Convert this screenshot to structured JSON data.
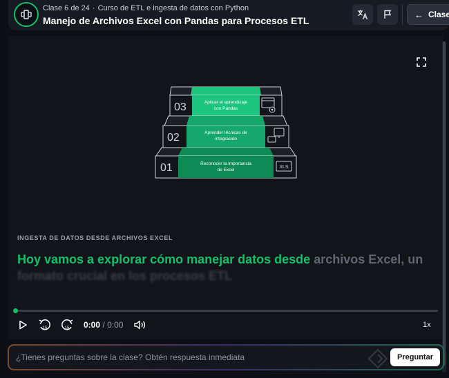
{
  "header": {
    "class_position": "Clase 6 de 24",
    "separator": "·",
    "course_name": "Curso de ETL e ingesta de datos con Python",
    "lesson_title": "Manejo de Archivos Excel con Pandas para Procesos ETL",
    "classes_button": "Clases",
    "translate_icon": "translate-icon",
    "flag_icon": "flag-icon"
  },
  "diagram": {
    "steps": [
      {
        "number": "03",
        "text_line1": "Aplicar el aprendizaje",
        "text_line2": "con Pandas",
        "icon": "browser-gear-icon"
      },
      {
        "number": "02",
        "text_line1": "Aprender técnicas de",
        "text_line2": "integración",
        "icon": "monitor-device-icon"
      },
      {
        "number": "01",
        "text_line1": "Reconocer la importancia",
        "text_line2": "de Excel",
        "icon": "xls-file-icon",
        "icon_label": "XLS"
      }
    ],
    "colors": {
      "top": "#1cc47e",
      "mid": "#15a86a",
      "bottom": "#0e8a55"
    }
  },
  "content": {
    "section_label": "INGESTA DE DATOS DESDE ARCHIVOS EXCEL",
    "caption_highlight": "Hoy vamos a explorar cómo manejar datos desde",
    "caption_rest": "archivos Excel, un",
    "caption_faded": "formato crucial en los procesos ETL"
  },
  "player": {
    "progress": 0,
    "current_time": "0:00",
    "time_separator": "/",
    "duration": "0:00",
    "rewind_label": "15",
    "forward_label": "15",
    "speed": "1x"
  },
  "ask": {
    "placeholder": "¿Tienes preguntas sobre la clase? Obtén respuesta inmediata",
    "button_label": "Preguntar"
  },
  "colors": {
    "accent": "#11c16b",
    "background": "#0d0f14",
    "header": "#161a22"
  }
}
